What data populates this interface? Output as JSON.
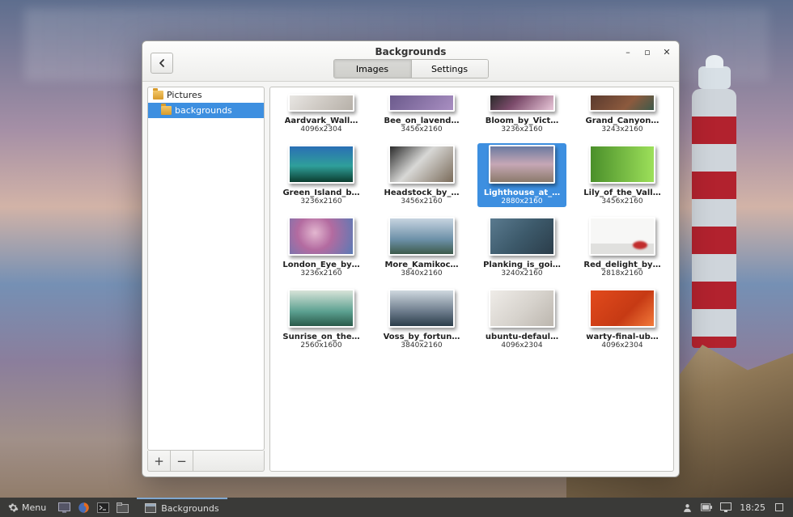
{
  "window": {
    "title": "Backgrounds",
    "tabs": {
      "images": "Images",
      "settings": "Settings"
    }
  },
  "sidebar": {
    "items": [
      {
        "label": "Pictures",
        "selected": false
      },
      {
        "label": "backgrounds",
        "selected": true
      }
    ],
    "add": "+",
    "remove": "−"
  },
  "thumbnails": [
    {
      "name": "Aardvark_Wall…",
      "dim": "4096x2304",
      "theme": "t0"
    },
    {
      "name": "Bee_on_lavend…",
      "dim": "3456x2160",
      "theme": "t1"
    },
    {
      "name": "Bloom_by_Vict…",
      "dim": "3236x2160",
      "theme": "t2"
    },
    {
      "name": "Grand_Canyon…",
      "dim": "3243x2160",
      "theme": "t3"
    },
    {
      "name": "Green_Island_b…",
      "dim": "3236x2160",
      "theme": "t4"
    },
    {
      "name": "Headstock_by_…",
      "dim": "3456x2160",
      "theme": "t5"
    },
    {
      "name": "Lighthouse_at_…",
      "dim": "2880x2160",
      "theme": "t6",
      "selected": true
    },
    {
      "name": "Lily_of_the_Vall…",
      "dim": "3456x2160",
      "theme": "t7"
    },
    {
      "name": "London_Eye_by…",
      "dim": "3236x2160",
      "theme": "t8"
    },
    {
      "name": "More_Kamikoc…",
      "dim": "3840x2160",
      "theme": "t9"
    },
    {
      "name": "Planking_is_goi…",
      "dim": "3240x2160",
      "theme": "t10"
    },
    {
      "name": "Red_delight_by…",
      "dim": "2818x2160",
      "theme": "t11"
    },
    {
      "name": "Sunrise_on_the…",
      "dim": "2560x1600",
      "theme": "t12"
    },
    {
      "name": "Voss_by_fortun…",
      "dim": "3840x2160",
      "theme": "t13"
    },
    {
      "name": "ubuntu-defaul…",
      "dim": "4096x2304",
      "theme": "t14"
    },
    {
      "name": "warty-final-ub…",
      "dim": "4096x2304",
      "theme": "t15"
    }
  ],
  "taskbar": {
    "menu": "Menu",
    "task": "Backgrounds",
    "clock": "18:25"
  }
}
